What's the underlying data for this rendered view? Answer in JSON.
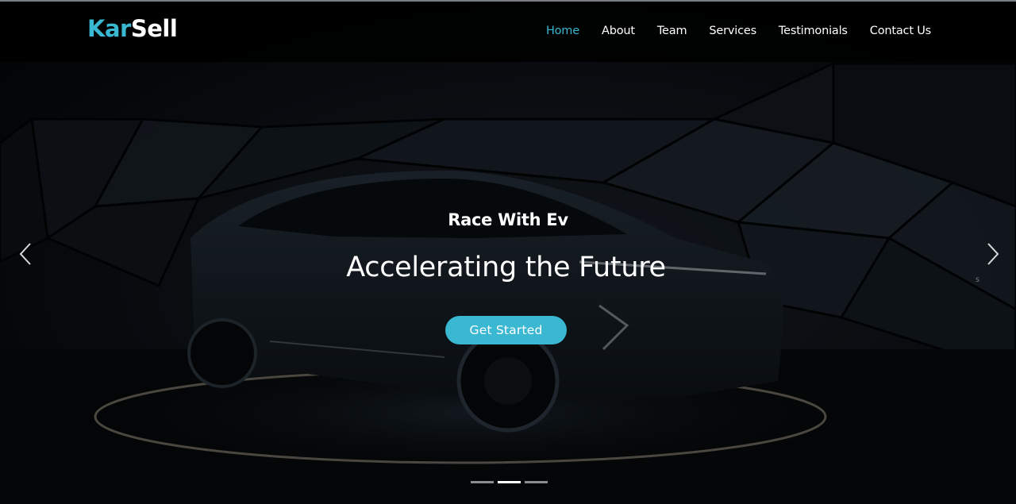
{
  "brand": {
    "part1": "Kar",
    "part2": "Sell",
    "accent": "#3ab7d1"
  },
  "nav": {
    "items": [
      {
        "label": "Home",
        "active": true
      },
      {
        "label": "About"
      },
      {
        "label": "Team"
      },
      {
        "label": "Services"
      },
      {
        "label": "Testimonials"
      },
      {
        "label": "Contact Us"
      }
    ]
  },
  "hero": {
    "subtitle": "Race With Ev",
    "title": "Accelerating the Future",
    "cta": "Get Started",
    "stray_text": "s",
    "prev_icon": "chevron-left-icon",
    "next_icon": "chevron-right-icon",
    "slides": 3,
    "active_slide": 2
  }
}
